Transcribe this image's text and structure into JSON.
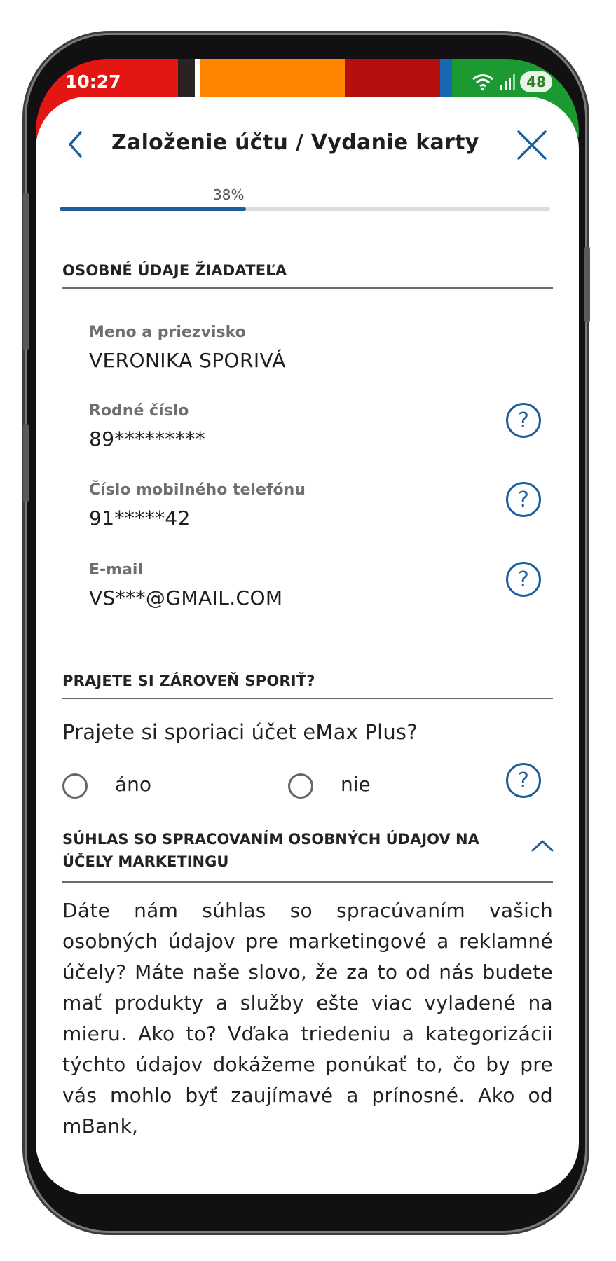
{
  "status_bar": {
    "time": "10:27",
    "battery": "48",
    "stripe_colors": [
      "#e31614",
      "#2b2223",
      "#ff8400",
      "#b30f0f",
      "#1a68b3",
      "#1b9a32"
    ]
  },
  "header": {
    "title": "Založenie účtu / Vydanie karty",
    "back_icon": "chevron-left-icon",
    "close_icon": "close-icon"
  },
  "progress": {
    "label": "38%",
    "value": 0.38
  },
  "personal_section": {
    "title": "OSOBNÉ ÚDAJE ŽIADATEĽA",
    "fields": [
      {
        "label": "Meno a priezvisko",
        "value": "VERONIKA SPORIVÁ"
      },
      {
        "label": "Rodné číslo",
        "value": "89*********"
      },
      {
        "label": "Číslo mobilného telefónu",
        "value": "91*****42"
      },
      {
        "label": "E-mail",
        "value": "VS***@GMAIL.COM"
      }
    ]
  },
  "savings_section": {
    "title": "PRAJETE SI ZÁROVEŇ SPORIŤ?",
    "question": "Prajete si sporiaci účet eMax Plus?",
    "options": [
      "áno",
      "nie"
    ]
  },
  "marketing_section": {
    "title": "SÚHLAS SO SPRACOVANÍM OSOBNÝCH ÚDAJOV NA ÚČELY MARKETINGU",
    "text": "Dáte nám súhlas so spracúvaním vašich osobných údajov pre marketingové a reklamné účely? Máte naše slovo, že za to od nás budete mať produkty a služby ešte viac vyladené na mieru. Ako to? Vďaka triedeniu a kategorizácii týchto údajov dokážeme ponúkať to, čo by pre vás mohlo byť zaujímavé a prínosné. Ako od mBank,"
  },
  "colors": {
    "accent": "#1d5f9e",
    "text": "#1e1e1e",
    "muted": "#6f6f6f"
  }
}
